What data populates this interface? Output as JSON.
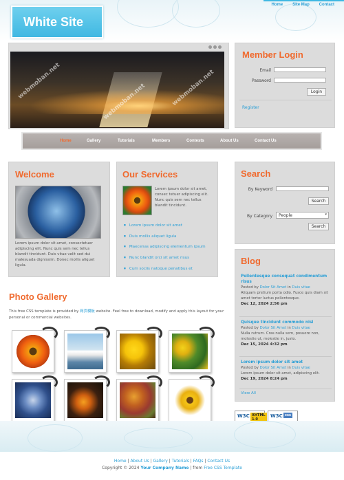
{
  "site": {
    "logo": "White Site"
  },
  "topnav": {
    "items": [
      "Home",
      "Site Map",
      "Contact"
    ]
  },
  "watermark": "webmoban.net",
  "login": {
    "title": "Member Login",
    "email_label": "Email",
    "password_label": "Password",
    "button": "Login",
    "register": "Register"
  },
  "mainnav": {
    "items": [
      "Home",
      "Gallery",
      "Tutorials",
      "Members",
      "Contests",
      "About Us",
      "Contact Us"
    ]
  },
  "welcome": {
    "title": "Welcome",
    "text": "Lorem ipsum dolor sit amet, consectetuer adipiscing elit. Nunc quis sem nec tellus blandit tincidunt. Duis vitae velit sed dui malesuada dignissim. Donec mollis aliquet ligula."
  },
  "services": {
    "title": "Our Services",
    "text": "Lorem ipsum dolor sit amet, consec tetuer adipiscing elit. Nunc quis sem nec tellus blandit tincidunt.",
    "items": [
      "Lorem ipsum dolor sit amet",
      "Duis mollis aliquet ligula",
      "Maecenas adipiscing elementum ipsum",
      "Nunc blandit orci sit amet risus",
      "Cum sociis natoque penatibus et"
    ]
  },
  "search": {
    "title": "Search",
    "keyword_label": "By Keyword",
    "category_label": "By Category",
    "category_value": "People",
    "button": "Search"
  },
  "blog": {
    "title": "Blog",
    "posts": [
      {
        "title": "Pellentesque consequat condimentum risus",
        "posted_by": "Posted by",
        "author": "Dolor Sit Amet",
        "in": "in",
        "category": "Duis vitae",
        "excerpt": "Aliquam pretium porta odio. Fusce quis diam sit amet tortor luctus pellentesque.",
        "date": "Dec 12, 2024 2:56 pm"
      },
      {
        "title": "Quisque tincidunt commodo nisl",
        "posted_by": "Posted by",
        "author": "Dolor Sit Amet",
        "in": "in",
        "category": "Duis vitae",
        "excerpt": "Nulla rutrum. Cras nulla sem, posuere non, molestie ut, molestie in, justo.",
        "date": "Dec 15, 2024 4:32 pm"
      },
      {
        "title": "Lorem ipsum dolor sit amet",
        "posted_by": "Posted by",
        "author": "Dolor Sit Amet",
        "in": "in",
        "category": "Duis vitae",
        "excerpt": "Lorem ipsum dolor sit amet, adipiscing elit.",
        "date": "Dec 19, 2024 8:24 pm"
      }
    ],
    "view_all": "View All"
  },
  "gallery": {
    "title": "Photo Gallery",
    "intro_before": "This free CSS template is provided by",
    "intro_link": "网页模板",
    "intro_after": "website. Feel free to download, modify and apply this layout for your personal or commercial websites."
  },
  "badges": {
    "xhtml_w": "W3C",
    "xhtml_t": "XHTML 1.0",
    "css_w": "W3C",
    "css_t": "css"
  },
  "footer": {
    "links": [
      "Home",
      "About Us",
      "Gallery",
      "Tutorials",
      "FAQs",
      "Contact Us"
    ],
    "copyright": "Copyright © 2024",
    "company": "Your Company Name",
    "from": "| from",
    "source": "Free CSS Template"
  },
  "colors": {
    "accent": "#f06a2e",
    "link": "#2a9fd6",
    "panel": "#dcdcdc"
  }
}
